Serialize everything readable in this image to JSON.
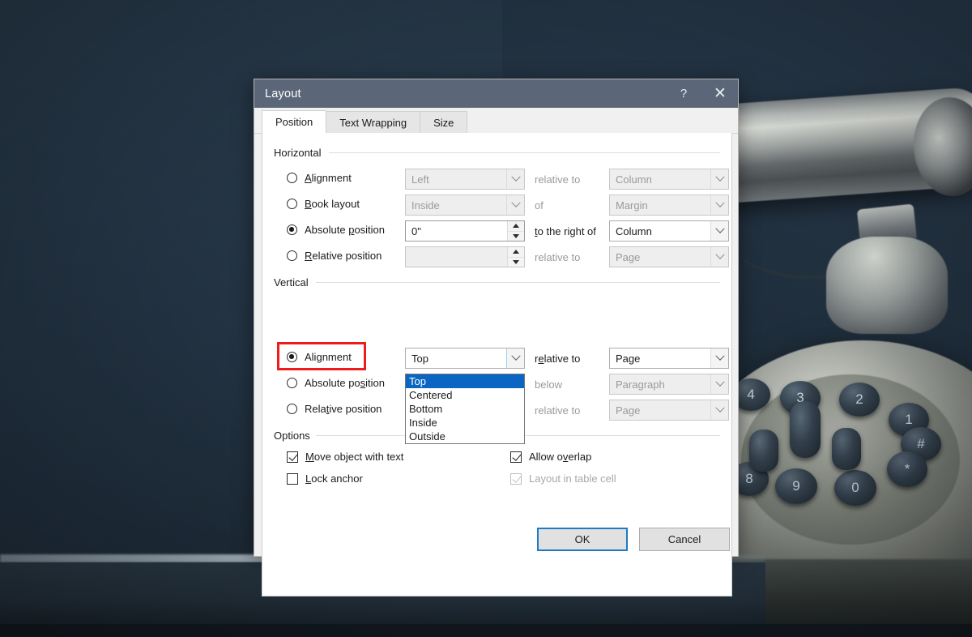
{
  "background": {
    "description": "vintage push-button telephone on dark blue-gray surface",
    "keys": [
      "1",
      "2",
      "3",
      "4",
      "#",
      "*",
      "0",
      "9",
      "8"
    ]
  },
  "dialog": {
    "title": "Layout",
    "help_button": "?",
    "close_button": "✕",
    "tabs": [
      {
        "label": "Position",
        "active": true
      },
      {
        "label": "Text Wrapping",
        "active": false
      },
      {
        "label": "Size",
        "active": false
      }
    ],
    "horizontal": {
      "group_label": "Horizontal",
      "rows": [
        {
          "radio_label": "Alignment",
          "mnemonic": "A",
          "selected": false,
          "control_type": "combo",
          "control_value": "Left",
          "control_enabled": false,
          "mid_label": "relative to",
          "mid_enabled": false,
          "right_value": "Column",
          "right_enabled": false
        },
        {
          "radio_label": "Book layout",
          "mnemonic": "B",
          "selected": false,
          "control_type": "combo",
          "control_value": "Inside",
          "control_enabled": false,
          "mid_label": "of",
          "mid_enabled": false,
          "right_value": "Margin",
          "right_enabled": false
        },
        {
          "radio_label": "Absolute position",
          "mnemonic": "p",
          "selected": true,
          "control_type": "spin",
          "control_value": "0\"",
          "control_enabled": true,
          "mid_label": "to the right of",
          "mid_enabled": true,
          "right_value": "Column",
          "right_enabled": true
        },
        {
          "radio_label": "Relative position",
          "mnemonic": "R",
          "selected": false,
          "control_type": "spin",
          "control_value": "",
          "control_enabled": false,
          "mid_label": "relative to",
          "mid_enabled": false,
          "right_value": "Page",
          "right_enabled": false
        }
      ]
    },
    "vertical": {
      "group_label": "Vertical",
      "rows": [
        {
          "radio_label": "Alignment",
          "mnemonic": "g",
          "selected": true,
          "control_type": "combo",
          "control_value": "Top",
          "control_enabled": true,
          "control_open": true,
          "mid_label": "relative to",
          "mid_enabled": true,
          "right_value": "Page",
          "right_enabled": true
        },
        {
          "radio_label": "Absolute position",
          "mnemonic": "s",
          "selected": false,
          "control_type": "spin",
          "control_value": "",
          "control_enabled": false,
          "mid_label": "below",
          "mid_enabled": false,
          "right_value": "Paragraph",
          "right_enabled": false
        },
        {
          "radio_label": "Relative position",
          "mnemonic": "t",
          "selected": false,
          "control_type": "spin",
          "control_value": "",
          "control_enabled": false,
          "mid_label": "relative to",
          "mid_enabled": false,
          "right_value": "Page",
          "right_enabled": false
        }
      ],
      "alignment_dropdown_options": [
        {
          "label": "Top",
          "selected": true
        },
        {
          "label": "Centered",
          "selected": false
        },
        {
          "label": "Bottom",
          "selected": false
        },
        {
          "label": "Inside",
          "selected": false
        },
        {
          "label": "Outside",
          "selected": false
        }
      ]
    },
    "options": {
      "group_label": "Options",
      "checkboxes": [
        {
          "label": "Move object with text",
          "checked": true,
          "enabled": true
        },
        {
          "label": "Lock anchor",
          "checked": false,
          "enabled": true
        },
        {
          "label": "Allow overlap",
          "checked": true,
          "enabled": true
        },
        {
          "label": "Layout in table cell",
          "checked": true,
          "enabled": false
        }
      ]
    },
    "footer": {
      "ok_label": "OK",
      "cancel_label": "Cancel"
    }
  },
  "annotation": {
    "highlight_target": "Vertical Alignment radio button",
    "color": "#ee1c1c"
  }
}
